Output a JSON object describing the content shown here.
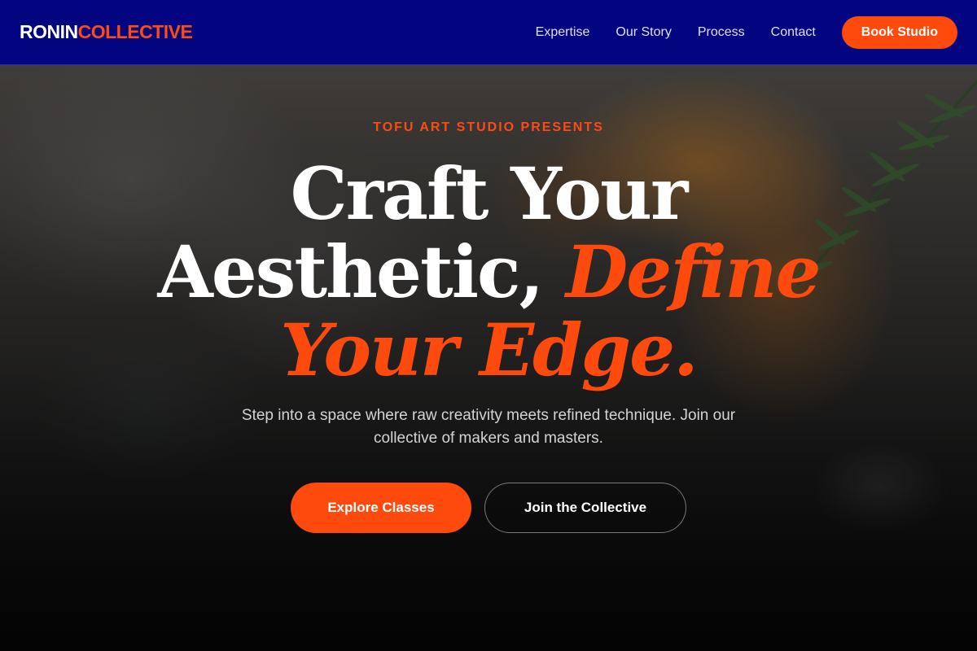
{
  "nav": {
    "logo_primary": "RONIN",
    "logo_accent": "COLLECTIVE",
    "links": [
      "Expertise",
      "Our Story",
      "Process",
      "Contact"
    ],
    "cta_label": "Book Studio"
  },
  "hero": {
    "eyebrow": "TOFU ART STUDIO PRESENTS",
    "headline_line1": "Craft Your",
    "headline_line2_plain": "Aesthetic, ",
    "headline_line2_accent": "Define",
    "headline_line3_accent": "Your Edge.",
    "subtitle": "Step into a space where raw creativity meets refined technique. Join our collective of makers and masters.",
    "primary_button": "Explore Classes",
    "secondary_button": "Join the Collective",
    "background_image": "textured-paint-palette-with-rosemary"
  },
  "colors": {
    "nav_bg": "#02057f",
    "accent": "#ff4a0d",
    "text_light": "#ffffff"
  }
}
